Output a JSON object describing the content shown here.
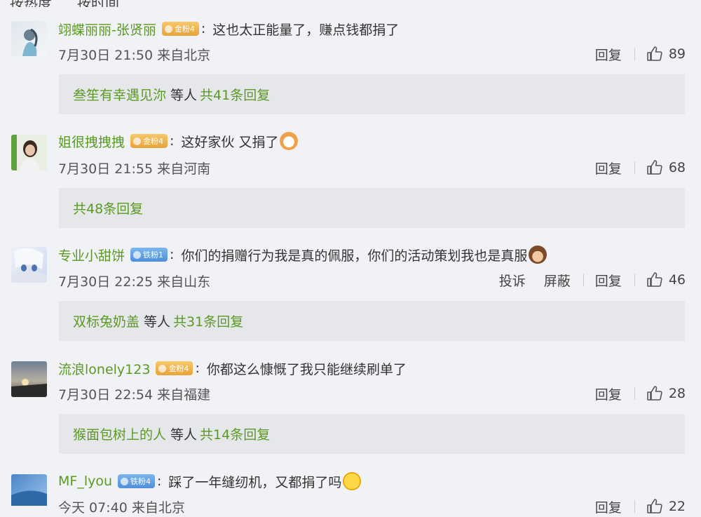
{
  "header": {
    "left_partial": "按热度",
    "right_partial": "按时间"
  },
  "comments": [
    {
      "username": "翊蝶丽丽-张贤丽",
      "badge": "金粉4",
      "badge_type": "gold",
      "text": "这也太正能量了，赚点钱都捐了",
      "date": "7月30日 21:50",
      "location": "来自北京",
      "actions": [
        "回复"
      ],
      "likes": "89",
      "replies": {
        "names": "叁笙有幸遇见沵",
        "mid": "等人",
        "count": "共41条回复"
      }
    },
    {
      "username": "姐很拽拽拽",
      "badge": "金粉4",
      "badge_type": "gold",
      "text": "这好家伙 又捐了",
      "emoji": "cat-emoji",
      "date": "7月30日 21:55",
      "location": "来自河南",
      "actions": [
        "回复"
      ],
      "likes": "68",
      "replies": {
        "names": "",
        "mid": "",
        "count": "共48条回复"
      }
    },
    {
      "username": "专业小甜饼",
      "badge": "铁粉1",
      "badge_type": "blue",
      "text": "你们的捐赠行为我是真的佩服，你们的活动策划我也是真服",
      "emoji": "monkey-emoji",
      "date": "7月30日 22:25",
      "location": "来自山东",
      "actions": [
        "投诉",
        "屏蔽",
        "回复"
      ],
      "likes": "46",
      "replies": {
        "names": "双标兔奶盖",
        "mid": "等人",
        "count": "共31条回复"
      }
    },
    {
      "username": "流浪lonely123",
      "badge": "金粉4",
      "badge_type": "gold",
      "text": "你都这么慷慨了我只能继续刷单了",
      "date": "7月30日 22:54",
      "location": "来自福建",
      "actions": [
        "回复"
      ],
      "likes": "28",
      "replies": {
        "names": "猴面包树上的人",
        "mid": "等人",
        "count": "共14条回复"
      }
    },
    {
      "username": "MF_lyou",
      "badge": "铁粉4",
      "badge_type": "blue",
      "text": "踩了一年缝纫机，又都捐了吗",
      "emoji": "crying-laughing-emoji",
      "date": "今天 07:40",
      "location": "来自北京",
      "actions": [
        "回复"
      ],
      "likes": "22"
    }
  ]
}
